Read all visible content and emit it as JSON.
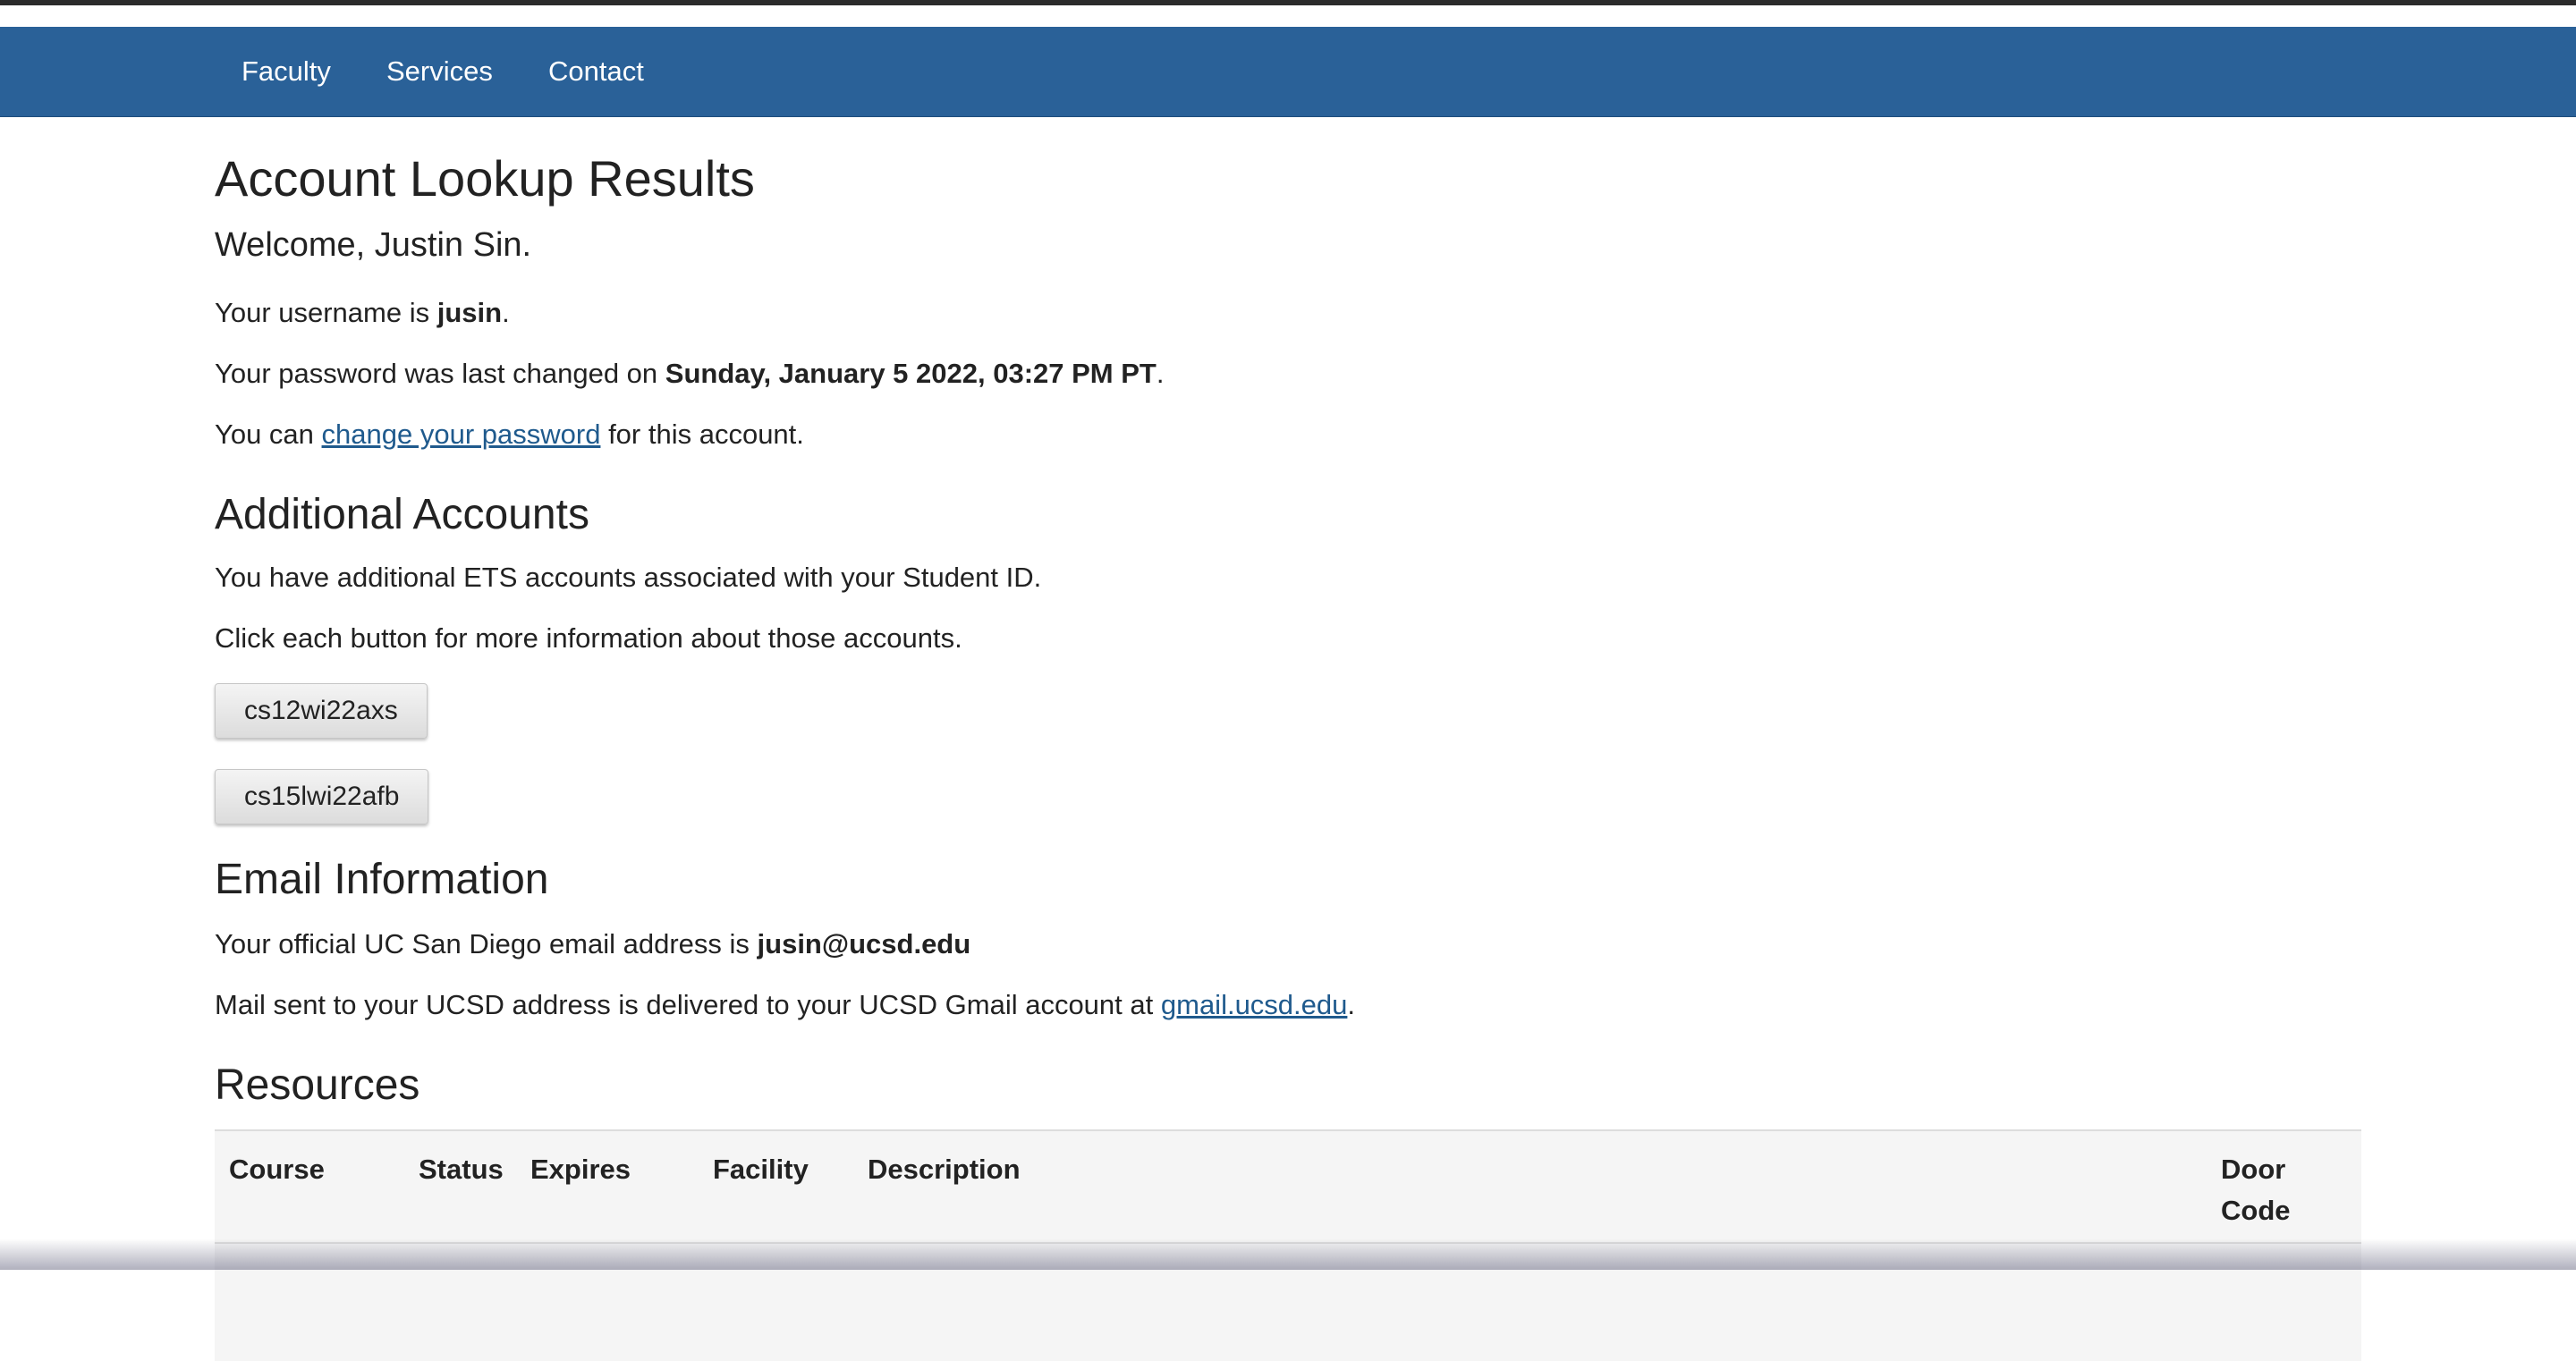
{
  "nav": {
    "items": [
      "Faculty",
      "Services",
      "Contact"
    ]
  },
  "page": {
    "title": "Account Lookup Results",
    "welcome": "Welcome, Justin Sin."
  },
  "account": {
    "username_prefix": "Your username is ",
    "username": "jusin",
    "username_suffix": ".",
    "password_prefix": "Your password was last changed on ",
    "password_date": "Sunday, January 5 2022, 03:27 PM PT",
    "password_suffix": ".",
    "change_prefix": "You can ",
    "change_link": "change your password",
    "change_suffix": " for this account."
  },
  "additional": {
    "heading": "Additional Accounts",
    "line1": "You have additional ETS accounts associated with your Student ID.",
    "line2": "Click each button for more information about those accounts.",
    "buttons": [
      "cs12wi22axs",
      "cs15lwi22afb"
    ]
  },
  "email": {
    "heading": "Email Information",
    "official_prefix": "Your official UC San Diego email address is ",
    "address": "jusin@ucsd.edu",
    "gmail_prefix": "Mail sent to your UCSD address is delivered to your UCSD Gmail account at ",
    "gmail_link": "gmail.ucsd.edu",
    "gmail_suffix": "."
  },
  "resources": {
    "heading": "Resources",
    "columns": [
      "Course",
      "Status",
      "Expires",
      "Facility",
      "Description",
      "Door",
      "Code"
    ]
  },
  "colors": {
    "navbar": "#2a6198",
    "link": "#1f5a8d"
  }
}
